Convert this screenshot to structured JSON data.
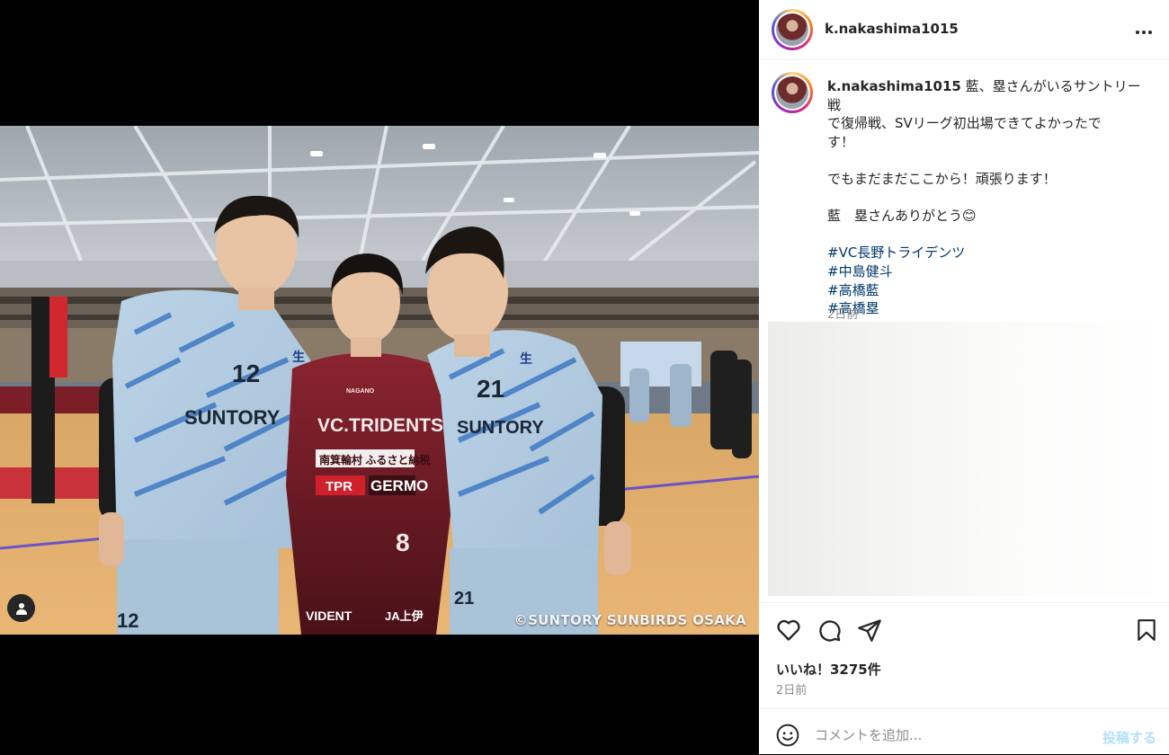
{
  "post": {
    "username": "k.nakashima1015",
    "photo_credit": "©SUNTORY SUNBIRDS OSAKA"
  },
  "photo_text": {
    "brand": "SUNTORY",
    "sponsor": "生",
    "left_number": "12",
    "right_number": "21",
    "center_number": "8",
    "center_team_small": "NAGANO",
    "center_team": "VC.TRIDENTS",
    "center_sponsor1": "南箕輪村 ふるさと納税",
    "center_sponsor2": "TPR",
    "center_sponsor3": "GERMO",
    "center_shorts_left": "VIDENT",
    "center_shorts_right": "JA上伊",
    "shorts_left_number": "12",
    "shorts_right_number": "21"
  },
  "caption": {
    "username": "k.nakashima1015",
    "line1": "藍、塁さんがいるサントリー戦",
    "line2": "で復帰戦、SVリーグ初出場できてよかったで",
    "line3": "す！",
    "line4": "でもまだまだここから！頑張ります！",
    "line5": "藍　塁さんありがとう😊",
    "hashtags": [
      "#VC長野トライデンツ",
      "#中島健斗",
      "#高橋藍",
      "#高橋塁"
    ],
    "time": "2日前"
  },
  "engagement": {
    "likes": "いいね！3275件",
    "time": "2日前"
  },
  "comment": {
    "placeholder": "コメントを追加...",
    "post_label": "投稿する"
  },
  "icons": {
    "more": "more-horizontal-icon",
    "like": "heart-icon",
    "comment": "comment-icon",
    "share": "paper-plane-icon",
    "save": "bookmark-icon",
    "emoji": "emoji-icon",
    "tagged_users": "user-tag-icon"
  },
  "colors": {
    "hashtag": "#00376b",
    "secondary_text": "#8e8e8e",
    "post_button": "#b2dffc"
  }
}
